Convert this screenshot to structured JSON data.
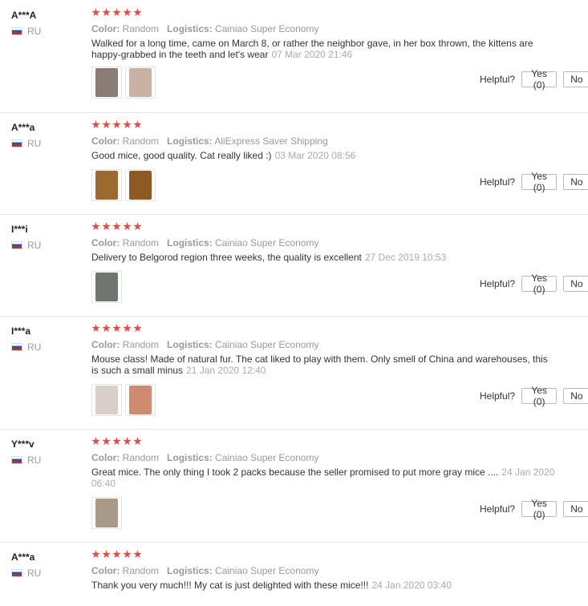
{
  "labels": {
    "color": "Color:",
    "logistics": "Logistics:",
    "helpful": "Helpful?",
    "yes": "Yes (0)",
    "no": "No"
  },
  "rating_max": 5,
  "reviews": [
    {
      "user": "A***A",
      "country": "RU",
      "rating": 5,
      "color": "Random",
      "logistics": "Cainiao Super Economy",
      "text": "Walked for a long time, came on March 8, or rather the neighbor gave, in her box thrown, the kittens are happy-grabbed in the teeth and let's wear",
      "date": "07 Mar 2020 21:46",
      "photos": [
        {
          "icon": "mouse-photo",
          "tone": "#8a7d74"
        },
        {
          "icon": "mouse-photo",
          "tone": "#c8b2a4"
        }
      ]
    },
    {
      "user": "A***a",
      "country": "RU",
      "rating": 5,
      "color": "Random",
      "logistics": "AliExpress Saver Shipping",
      "text": "Good mice, good quality. Cat really liked :)",
      "date": "03 Mar 2020 08:56",
      "photos": [
        {
          "icon": "mouse-photo",
          "tone": "#9c6a2e"
        },
        {
          "icon": "mouse-photo",
          "tone": "#8e5a22"
        }
      ]
    },
    {
      "user": "I***i",
      "country": "RU",
      "rating": 5,
      "color": "Random",
      "logistics": "Cainiao Super Economy",
      "text": "Delivery to Belgorod region three weeks, the quality is excellent",
      "date": "27 Dec 2019 10:53",
      "photos": [
        {
          "icon": "mouse-photo",
          "tone": "#6f7670"
        }
      ]
    },
    {
      "user": "I***a",
      "country": "RU",
      "rating": 5,
      "color": "Random",
      "logistics": "Cainiao Super Economy",
      "text": "Mouse class! Made of natural fur. The cat liked to play with them. Only smell of China and warehouses, this is such a small minus",
      "date": "21 Jan 2020 12:40",
      "photos": [
        {
          "icon": "mouse-photo",
          "tone": "#d8cfc6"
        },
        {
          "icon": "mouse-photo",
          "tone": "#d08a70"
        }
      ]
    },
    {
      "user": "Y***v",
      "country": "RU",
      "rating": 5,
      "color": "Random",
      "logistics": "Cainiao Super Economy",
      "text": "Great mice. The only thing I took 2 packs because the seller promised to put more gray mice ....",
      "date": "24 Jan 2020 06:40",
      "photos": [
        {
          "icon": "mouse-photo",
          "tone": "#a89a86"
        }
      ]
    },
    {
      "user": "A***a",
      "country": "RU",
      "rating": 5,
      "color": "Random",
      "logistics": "Cainiao Super Economy",
      "text": "Thank you very much!!! My cat is just delighted with these mice!!!",
      "date": "24 Jan 2020 03:40",
      "photos": []
    }
  ]
}
